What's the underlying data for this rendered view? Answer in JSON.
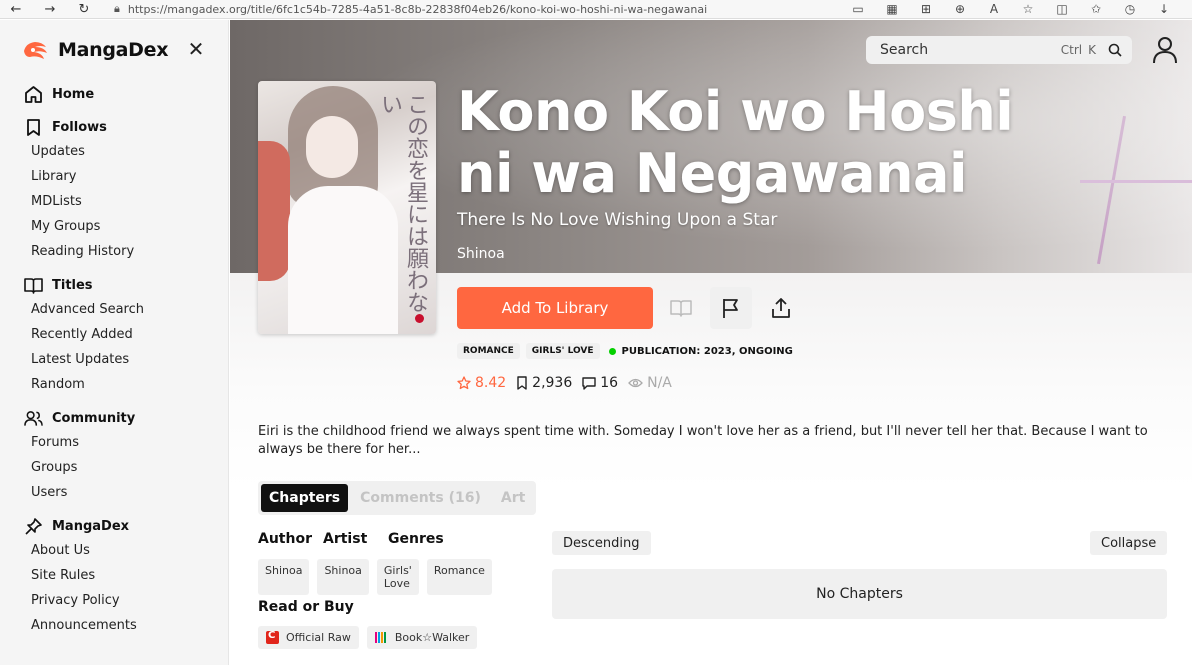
{
  "browser": {
    "url": "https://mangadex.org/title/6fc1c54b-7285-4a51-8c8b-22838f04eb26/kono-koi-wo-hoshi-ni-wa-negawanai"
  },
  "sidebar": {
    "logo_text": "MangaDex",
    "sections": [
      {
        "label": "Home",
        "icon": "home-icon",
        "items": []
      },
      {
        "label": "Follows",
        "icon": "bookmark-icon",
        "items": [
          "Updates",
          "Library",
          "MDLists",
          "My Groups",
          "Reading History"
        ]
      },
      {
        "label": "Titles",
        "icon": "book-open-icon",
        "items": [
          "Advanced Search",
          "Recently Added",
          "Latest Updates",
          "Random"
        ]
      },
      {
        "label": "Community",
        "icon": "users-icon",
        "items": [
          "Forums",
          "Groups",
          "Users"
        ]
      },
      {
        "label": "MangaDex",
        "icon": "pin-icon",
        "items": [
          "About Us",
          "Site Rules",
          "Privacy Policy",
          "Announcements"
        ]
      }
    ]
  },
  "search": {
    "placeholder": "Search",
    "shortcut_ctrl": "Ctrl",
    "shortcut_key": "K"
  },
  "manga": {
    "title": "Kono Koi wo Hoshi ni wa Negawanai",
    "alt_title": "There Is No Love Wishing Upon a Star",
    "author": "Shinoa",
    "cover_text": "この恋を星には願わない",
    "add_button": "Add To Library",
    "tags": [
      "ROMANCE",
      "GIRLS' LOVE"
    ],
    "publication": "PUBLICATION: 2023, ONGOING",
    "publication_color": "#04d000",
    "rating": "8.42",
    "follows": "2,936",
    "comments": "16",
    "views": "N/A",
    "description": "Eiri is the childhood friend we always spent time with. Someday I won't love her as a friend, but I'll never tell her that. Because I want to always be there for her..."
  },
  "tabs": [
    {
      "label": "Chapters",
      "active": true
    },
    {
      "label": "Comments (16)",
      "active": false
    },
    {
      "label": "Art",
      "active": false
    }
  ],
  "info": {
    "author_head": "Author",
    "artist_head": "Artist",
    "genres_head": "Genres",
    "author": "Shinoa",
    "artist": "Shinoa",
    "genres": [
      "Girls' Love",
      "Romance"
    ],
    "read_or_buy": "Read or Buy",
    "buy_links": [
      "Official Raw",
      "Book☆Walker"
    ]
  },
  "chapters": {
    "sort_label": "Descending",
    "collapse_label": "Collapse",
    "empty_label": "No Chapters"
  },
  "colors": {
    "accent": "#ff6740"
  }
}
